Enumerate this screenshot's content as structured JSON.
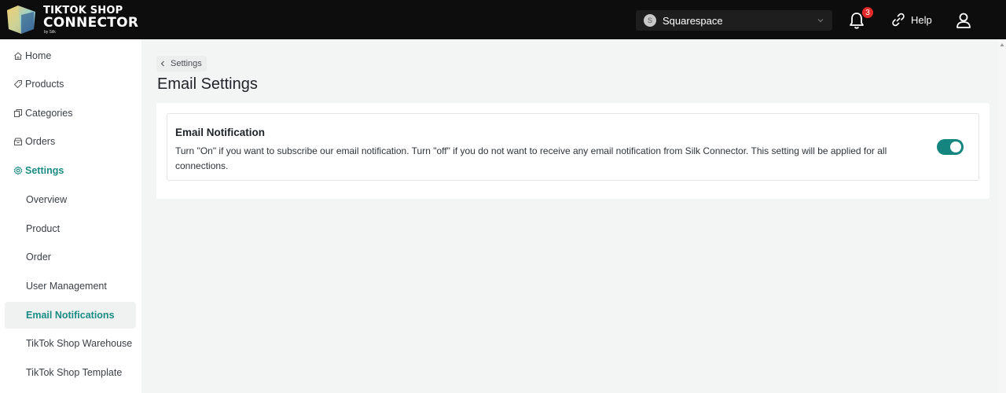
{
  "brand": {
    "line1": "TIKTOK SHOP",
    "line2": "CONNECTOR",
    "line3": "by Silk",
    "colors": {
      "teal": "#1a8c84",
      "dark": "#0d0d0d",
      "badge": "#e32b2b"
    }
  },
  "header": {
    "store": {
      "initial": "S",
      "name": "Squarespace"
    },
    "notifications": {
      "count": "3"
    },
    "help_label": "Help"
  },
  "sidebar": {
    "items": [
      {
        "label": "Home",
        "icon": "home-icon"
      },
      {
        "label": "Products",
        "icon": "tag-icon"
      },
      {
        "label": "Categories",
        "icon": "copy-icon"
      },
      {
        "label": "Orders",
        "icon": "box-icon"
      },
      {
        "label": "Settings",
        "icon": "gear-icon"
      }
    ],
    "subitems": [
      {
        "label": "Overview"
      },
      {
        "label": "Product"
      },
      {
        "label": "Order"
      },
      {
        "label": "User Management"
      },
      {
        "label": "Email Notifications"
      },
      {
        "label": "TikTok Shop Warehouse"
      },
      {
        "label": "TikTok Shop Template"
      }
    ]
  },
  "main": {
    "breadcrumb": "Settings",
    "title": "Email Settings",
    "card": {
      "title": "Email Notification",
      "description": "Turn \"On\" if you want to subscribe our email notification. Turn \"off\" if you do not want to receive any email notification from Silk Connector. This setting will be applied for all connections.",
      "toggle_on": true
    }
  }
}
